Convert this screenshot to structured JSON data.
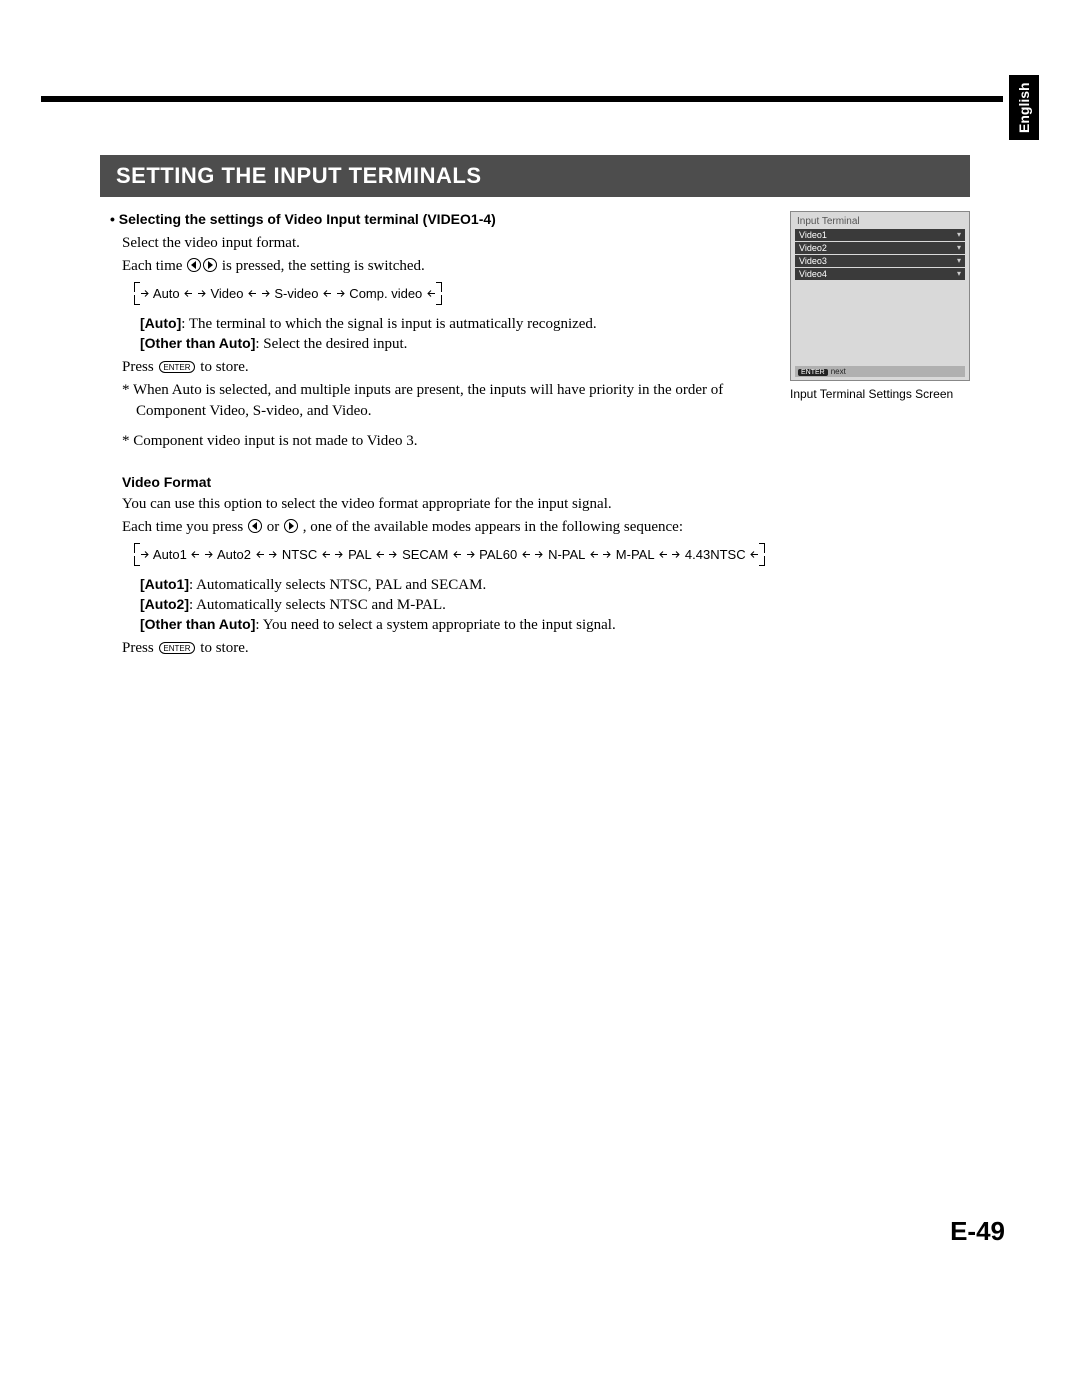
{
  "language_tab": "English",
  "section_title": "SETTING THE INPUT TERMINALS",
  "s1": {
    "bullet": "• Selecting the settings of Video Input terminal (VIDEO1-4)",
    "p1": "Select the video input format.",
    "p2a": "Each time ",
    "p2b": " is pressed, the setting is switched.",
    "seq": [
      "Auto",
      "Video",
      "S-video",
      "Comp. video"
    ],
    "auto_label": "Auto",
    "auto_txt": ": The terminal to which the signal is input is autmatically recognized.",
    "other_label": "[Other than Auto]",
    "other_txt": ": Select the desired input.",
    "press_a": "Press ",
    "press_b": " to store.",
    "star1": "* When Auto is selected, and multiple inputs are present, the inputs will have priority in the order of Component Video, S-video, and Video.",
    "star2": "* Component video input is not made to Video 3."
  },
  "screen": {
    "title": "Input Terminal",
    "rows": [
      "Video1",
      "Video2",
      "Video3",
      "Video4"
    ],
    "foot_chip": "ENTER",
    "foot_txt": "next",
    "caption": "Input Terminal Settings Screen"
  },
  "s2": {
    "title": "Video Format",
    "p1": "You can use this option to select the video format appropriate for the input signal.",
    "p2a": "Each time you press ",
    "p2_or": " or ",
    "p2b": ", one of the available modes appears in the following sequence:",
    "seq": [
      "Auto1",
      "Auto2",
      "NTSC",
      "PAL",
      "SECAM",
      "PAL60",
      "N-PAL",
      "M-PAL",
      "4.43NTSC"
    ],
    "a1_label": "[Auto1]",
    "a1_txt": ": Automatically selects NTSC, PAL and SECAM.",
    "a2_label": "[Auto2]",
    "a2_txt": ": Automatically selects NTSC and M-PAL.",
    "oth_label": "[Other than Auto]",
    "oth_txt": ": You need to select a system appropriate to the input signal.",
    "press_a": "Press ",
    "press_b": " to store."
  },
  "enter_label": "ENTER",
  "page_num": "E-49"
}
